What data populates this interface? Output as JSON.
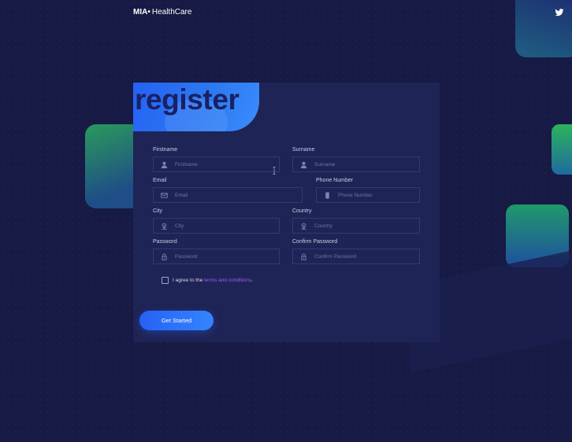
{
  "brand": {
    "prefix": "MIA•",
    "name": " HealthCare"
  },
  "form": {
    "title": "register",
    "firstname": {
      "label": "Firstname",
      "placeholder": "Firstname"
    },
    "surname": {
      "label": "Surname",
      "placeholder": "Surname"
    },
    "email": {
      "label": "Email",
      "placeholder": "Email"
    },
    "phone": {
      "label": "Phone Number",
      "placeholder": "Phone Number"
    },
    "city": {
      "label": "City",
      "placeholder": "City"
    },
    "country": {
      "label": "Country",
      "placeholder": "Country"
    },
    "password": {
      "label": "Password",
      "placeholder": "Password"
    },
    "confirm_password": {
      "label": "Confirm Password",
      "placeholder": "Confirm Password"
    },
    "agree_prefix": "I agree to the ",
    "terms_link": "terms and conditions",
    "agree_suffix": ".",
    "submit_label": "Get Started"
  },
  "icons": {
    "twitter": "twitter-icon",
    "user": "user-icon",
    "mail": "mail-icon",
    "phone": "phone-icon",
    "location": "location-pin-icon",
    "lock": "lock-icon"
  },
  "colors": {
    "background": "#161a44",
    "card": "#1f2456",
    "accent": "#2561f5",
    "link": "#a05bff"
  }
}
